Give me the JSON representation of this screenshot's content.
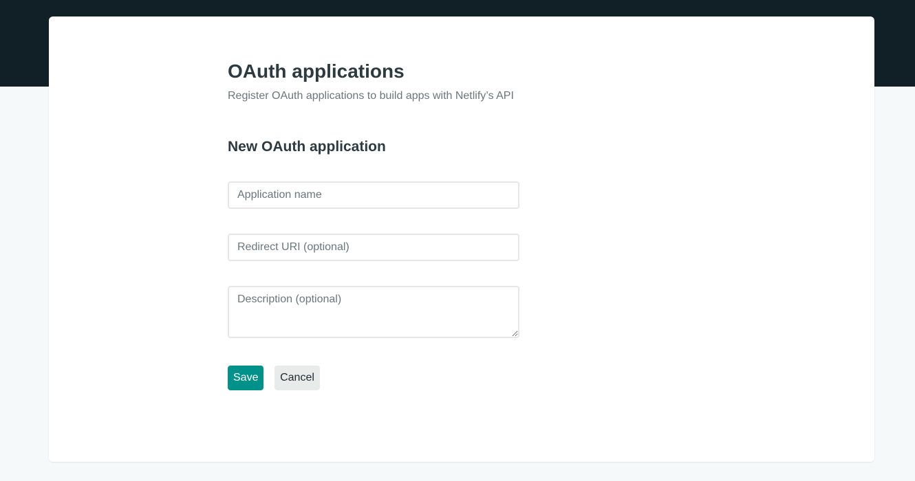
{
  "page": {
    "title": "OAuth applications",
    "subtitle": "Register OAuth applications to build apps with Netlify’s API"
  },
  "form": {
    "heading": "New OAuth application",
    "application_name": {
      "value": "",
      "placeholder": "Application name"
    },
    "redirect_uri": {
      "value": "",
      "placeholder": "Redirect URI (optional)"
    },
    "description": {
      "value": "",
      "placeholder": "Description (optional)"
    },
    "save_label": "Save",
    "cancel_label": "Cancel"
  },
  "colors": {
    "header_background": "#111f26",
    "page_background": "#f6f9f9",
    "primary_button": "#00928a",
    "secondary_button": "#e9ebeb",
    "heading_text": "#2d3b41",
    "muted_text": "#6b767c"
  }
}
